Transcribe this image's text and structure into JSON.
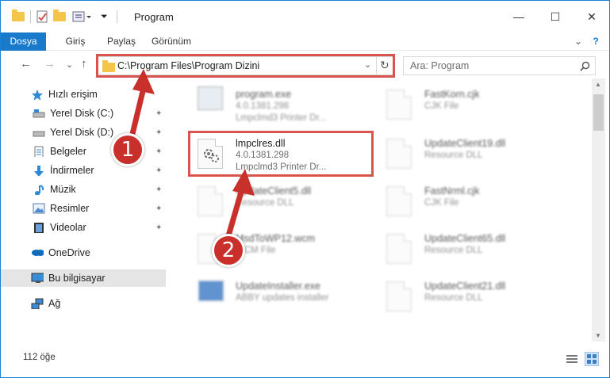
{
  "window": {
    "title": "Program",
    "minimize_glyph": "—",
    "maximize_glyph": "☐",
    "close_glyph": "✕"
  },
  "ribbon": {
    "tabs": [
      {
        "label": "Dosya",
        "active": true
      },
      {
        "label": "Giriş"
      },
      {
        "label": "Paylaş"
      },
      {
        "label": "Görünüm"
      }
    ],
    "expand_glyph": "⌄",
    "help_glyph": "?"
  },
  "navigation": {
    "back_glyph": "←",
    "forward_glyph": "→",
    "recent_glyph": "⌄",
    "up_glyph": "↑",
    "address": "C:\\Program Files\\Program Dizini",
    "refresh_glyph": "↻",
    "search_placeholder": "Ara: Program"
  },
  "nav_pane": {
    "items": [
      {
        "label": "Hızlı erişim",
        "icon": "star-icon"
      },
      {
        "label": "Yerel Disk (C:)",
        "icon": "drive-icon",
        "pinned": true
      },
      {
        "label": "Yerel Disk (D:)",
        "icon": "drive-icon",
        "pinned": true
      },
      {
        "label": "Belgeler",
        "icon": "documents-icon",
        "pinned": true
      },
      {
        "label": "İndirmeler",
        "icon": "downloads-icon",
        "pinned": true
      },
      {
        "label": "Müzik",
        "icon": "music-icon",
        "pinned": true
      },
      {
        "label": "Resimler",
        "icon": "pictures-icon",
        "pinned": true
      },
      {
        "label": "Videolar",
        "icon": "videos-icon",
        "pinned": true
      },
      {
        "label": "OneDrive",
        "icon": "cloud-icon"
      },
      {
        "label": "Bu bilgisayar",
        "icon": "computer-icon",
        "selected": true
      },
      {
        "label": "Ağ",
        "icon": "network-icon"
      }
    ],
    "pin_glyph": "📌"
  },
  "files": [
    {
      "name": "program.exe",
      "line1": "4.0.1381.298",
      "line2": "Lmpclmd3 Printer Dr...",
      "blurred": true
    },
    {
      "name": "FastKorn.cjk",
      "line1": "CJK File",
      "line2": "",
      "blurred": true
    },
    {
      "name": "lmpclres.dll",
      "line1": "4.0.1381.298",
      "line2": "Lmpclmd3 Printer Dr...",
      "blurred": false
    },
    {
      "name": "UpdateClient19.dll",
      "line1": "Resource DLL",
      "line2": "",
      "blurred": true
    },
    {
      "name": "UpdateClient5.dll",
      "line1": "Resource DLL",
      "line2": "",
      "blurred": true
    },
    {
      "name": "FastNrml.cjk",
      "line1": "CJK File",
      "line2": "",
      "blurred": true
    },
    {
      "name": "MsdToWP12.wcm",
      "line1": "WCM File",
      "line2": "",
      "blurred": true
    },
    {
      "name": "UpdateClient65.dll",
      "line1": "Resource DLL",
      "line2": "",
      "blurred": true
    },
    {
      "name": "UpdateInstaller.exe",
      "line1": "ABBY updates installer",
      "line2": "",
      "blurred": true
    },
    {
      "name": "UpdateClient21.dll",
      "line1": "Resource DLL",
      "line2": "",
      "blurred": true
    }
  ],
  "status": {
    "item_count": "112 öğe"
  },
  "callouts": [
    "1",
    "2"
  ],
  "colors": {
    "accent": "#1979ca",
    "highlight": "#d9534f",
    "callout": "#c9302c"
  }
}
